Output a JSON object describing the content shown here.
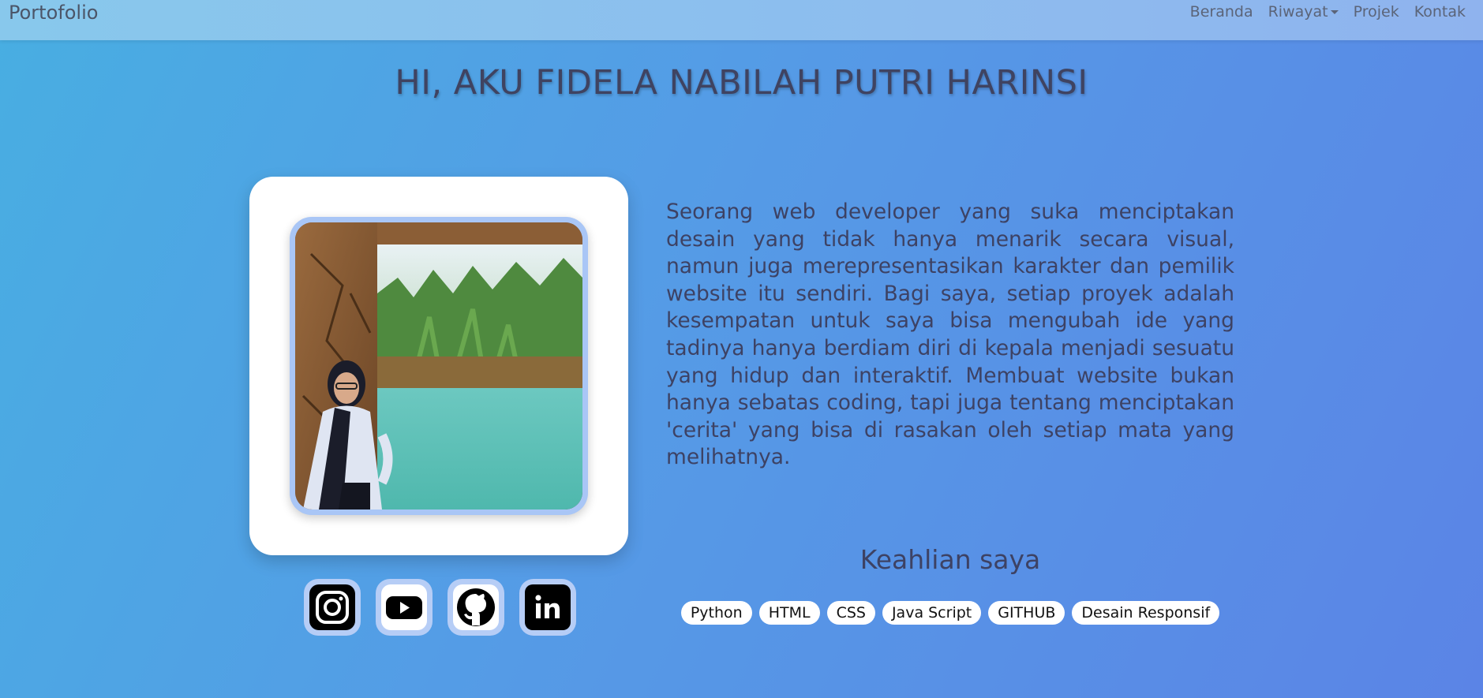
{
  "navbar": {
    "brand": "Portofolio",
    "links": [
      {
        "label": "Beranda"
      },
      {
        "label": "Riwayat",
        "dropdown": true
      },
      {
        "label": "Projek"
      },
      {
        "label": "Kontak"
      }
    ]
  },
  "hero": {
    "title": "HI, AKU FIDELA NABILAH PUTRI HARINSI"
  },
  "about": {
    "bio": "Seorang web developer yang suka menciptakan desain yang tidak hanya menarik secara visual, namun juga merepresentasikan karakter dan pemilik website itu sendiri. Bagi saya, setiap proyek adalah kesempatan untuk saya bisa mengubah ide yang tadinya hanya berdiam diri di kepala menjadi sesuatu yang hidup dan interaktif. Membuat website bukan hanya sebatas coding, tapi juga tentang menciptakan 'cerita' yang bisa di rasakan oleh setiap mata yang melihatnya."
  },
  "skills": {
    "title": "Keahlian saya",
    "items": [
      "Python",
      "HTML",
      "CSS",
      "Java Script",
      "GITHUB",
      "Desain Responsif"
    ]
  },
  "social": [
    {
      "icon": "instagram-icon"
    },
    {
      "icon": "youtube-icon"
    },
    {
      "icon": "github-icon"
    },
    {
      "icon": "linkedin-icon"
    }
  ],
  "colors": {
    "background_start": "#48aee2",
    "background_end": "#5b84e6",
    "navbar": "#8dbdee",
    "title_text": "#3f4361",
    "card": "#ffffff",
    "photo_border": "#a9c6f6"
  }
}
